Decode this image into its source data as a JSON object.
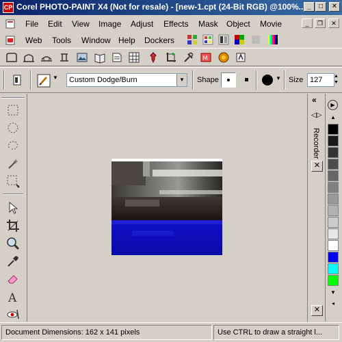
{
  "window": {
    "title": "Corel PHOTO-PAINT X4 (Not for resale) - [new-1.cpt (24-Bit RGB) @100%...",
    "app_icon_text": "CP"
  },
  "menu": {
    "row1": [
      "File",
      "Edit",
      "View",
      "Image",
      "Adjust",
      "Effects",
      "Mask",
      "Object",
      "Movie"
    ],
    "row2": [
      "Web",
      "Tools",
      "Window",
      "Help",
      "Dockers"
    ]
  },
  "property_bar": {
    "brush_type": "Custom Dodge/Burn",
    "shape_label": "Shape",
    "size_label": "Size",
    "size_value": "127"
  },
  "docker": {
    "title": "Recorder"
  },
  "palette": {
    "colors": [
      "#000000",
      "#1a1a1a",
      "#333333",
      "#4d4d4d",
      "#666666",
      "#808080",
      "#999999",
      "#b3b3b3",
      "#cccccc",
      "#e6e6e6",
      "#ffffff",
      "#0000ff",
      "#00ffff",
      "#00ff00"
    ]
  },
  "status": {
    "dimensions": "Document Dimensions: 162 x 141 pixels",
    "hint": "Use CTRL to draw a straight l..."
  }
}
